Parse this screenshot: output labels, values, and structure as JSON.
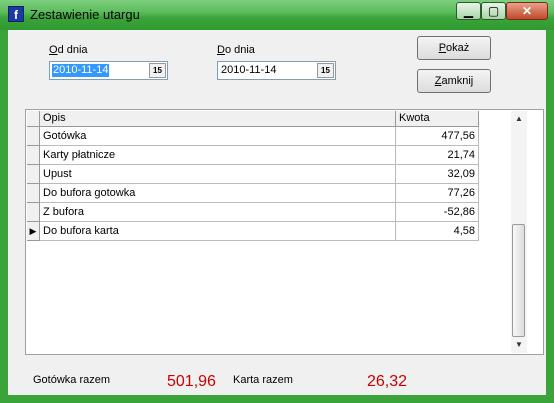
{
  "window": {
    "title": "Zestawienie utargu",
    "app_icon": "f",
    "accent": "#3aa33a"
  },
  "controls": {
    "minimize_icon": "minimize-icon",
    "maximize_icon": "maximize-icon",
    "close_icon": "close-icon"
  },
  "filters": {
    "from_label_hot": "O",
    "from_label_rest": "d dnia",
    "from_value": "2010-11-14",
    "to_label_hot": "D",
    "to_label_rest": "o dnia",
    "to_value": "2010-11-14",
    "calendar_glyph": "15"
  },
  "buttons": {
    "show_hot": "P",
    "show_rest": "okaż",
    "close_hot": "Z",
    "close_rest": "amknij"
  },
  "table": {
    "columns": [
      "Opis",
      "Kwota"
    ],
    "rows": [
      {
        "opis": "Gotówka",
        "kwota": "477,56"
      },
      {
        "opis": "Karty płatnicze",
        "kwota": "21,74"
      },
      {
        "opis": "Upust",
        "kwota": "32,09"
      },
      {
        "opis": "Do bufora gotowka",
        "kwota": "77,26"
      },
      {
        "opis": "Z bufora",
        "kwota": "-52,86"
      },
      {
        "opis": "Do bufora karta",
        "kwota": "4,58",
        "current": true
      }
    ]
  },
  "summary": {
    "cash_label": "Gotówka razem",
    "cash_value": "501,96",
    "card_label": "Karta razem",
    "card_value": "26,32",
    "value_color": "#cc0000"
  }
}
